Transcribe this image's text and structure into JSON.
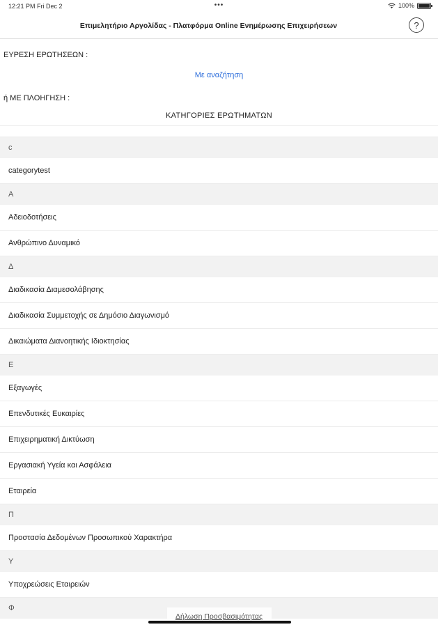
{
  "status_bar": {
    "time_date": "12:21 PM   Fri Dec 2",
    "center_dots": "•••",
    "battery": "100%",
    "battery_level": 1.0
  },
  "nav": {
    "title": "Επιμελητήριο Αργολίδας - Πλατφόρμα Online Ενημέρωσης Επιχειρήσεων",
    "help_glyph": "?"
  },
  "search": {
    "find_label": "ΕΥΡΕΣΗ ΕΡΩΤΗΣΕΩΝ :",
    "search_link": "Με αναζήτηση",
    "browse_label": "ή ΜΕ ΠΛΟΗΓΗΣΗ :",
    "categories_header": "ΚΑΤΗΓΟΡΙΕΣ ΕΡΩΤΗΜΑΤΩΝ"
  },
  "list": [
    {
      "type": "section",
      "label": "c"
    },
    {
      "type": "item",
      "label": "categorytest"
    },
    {
      "type": "section",
      "label": "A"
    },
    {
      "type": "item",
      "label": "Αδειοδοτήσεις"
    },
    {
      "type": "item",
      "label": "Ανθρώπινο Δυναμικό"
    },
    {
      "type": "section",
      "label": "Δ"
    },
    {
      "type": "item",
      "label": "Διαδικασία Διαμεσολάβησης"
    },
    {
      "type": "item",
      "label": "Διαδικασία Συμμετοχής σε Δημόσιο Διαγωνισμό"
    },
    {
      "type": "item",
      "label": "Δικαιώματα Διανοητικής Ιδιοκτησίας"
    },
    {
      "type": "section",
      "label": "E"
    },
    {
      "type": "item",
      "label": "Εξαγωγές"
    },
    {
      "type": "item",
      "label": "Επενδυτικές Ευκαιρίες"
    },
    {
      "type": "item",
      "label": "Επιχειρηματική Δικτύωση"
    },
    {
      "type": "item",
      "label": "Εργασιακή Υγεία και Ασφάλεια"
    },
    {
      "type": "item",
      "label": "Εταιρεία"
    },
    {
      "type": "section",
      "label": "Π"
    },
    {
      "type": "item",
      "label": "Προστασία Δεδομένων Προσωπικού Χαρακτήρα"
    },
    {
      "type": "section",
      "label": "Υ"
    },
    {
      "type": "item",
      "label": "Υποχρεώσεις Εταιρειών"
    },
    {
      "type": "section",
      "label": "Φ"
    }
  ],
  "footer": {
    "accessibility_link": "Δήλωση Προσβασιμότητας"
  },
  "colors": {
    "link": "#2f6fdb",
    "section_bg": "#f2f2f2"
  },
  "icons": [
    "wifi-icon",
    "battery-icon",
    "help-icon"
  ]
}
